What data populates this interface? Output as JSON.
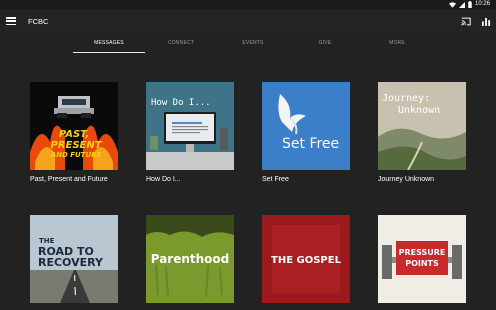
{
  "status_bar": {
    "time": "10:26"
  },
  "app_bar": {
    "title": "FCBC"
  },
  "tabs": [
    {
      "label": "MESSAGES",
      "active": true
    },
    {
      "label": "CONNECT",
      "active": false
    },
    {
      "label": "EVENTS",
      "active": false
    },
    {
      "label": "GIVE",
      "active": false
    },
    {
      "label": "MORE",
      "active": false
    }
  ],
  "series": [
    {
      "title": "Past, Present and Future",
      "art_text": [
        "PAST,",
        "PRESENT",
        "AND FUTURE"
      ]
    },
    {
      "title": "How Do I...",
      "art_text": "How Do I..."
    },
    {
      "title": "Set Free",
      "art_text": "Set Free"
    },
    {
      "title": "Journey Unknown",
      "art_text": [
        "Journey:",
        "Unknown"
      ]
    },
    {
      "title": "",
      "art_text": [
        "THE",
        "ROAD TO",
        "RECOVERY"
      ]
    },
    {
      "title": "",
      "art_text": "Parenthood"
    },
    {
      "title": "",
      "art_text": "THE GOSPEL"
    },
    {
      "title": "",
      "art_text": [
        "PRESSURE",
        "POINTS"
      ]
    }
  ],
  "colors": {
    "background": "#222222",
    "app_bar": "#232323",
    "tab_active": "#ffffff",
    "tab_inactive": "#9a9a9a"
  }
}
